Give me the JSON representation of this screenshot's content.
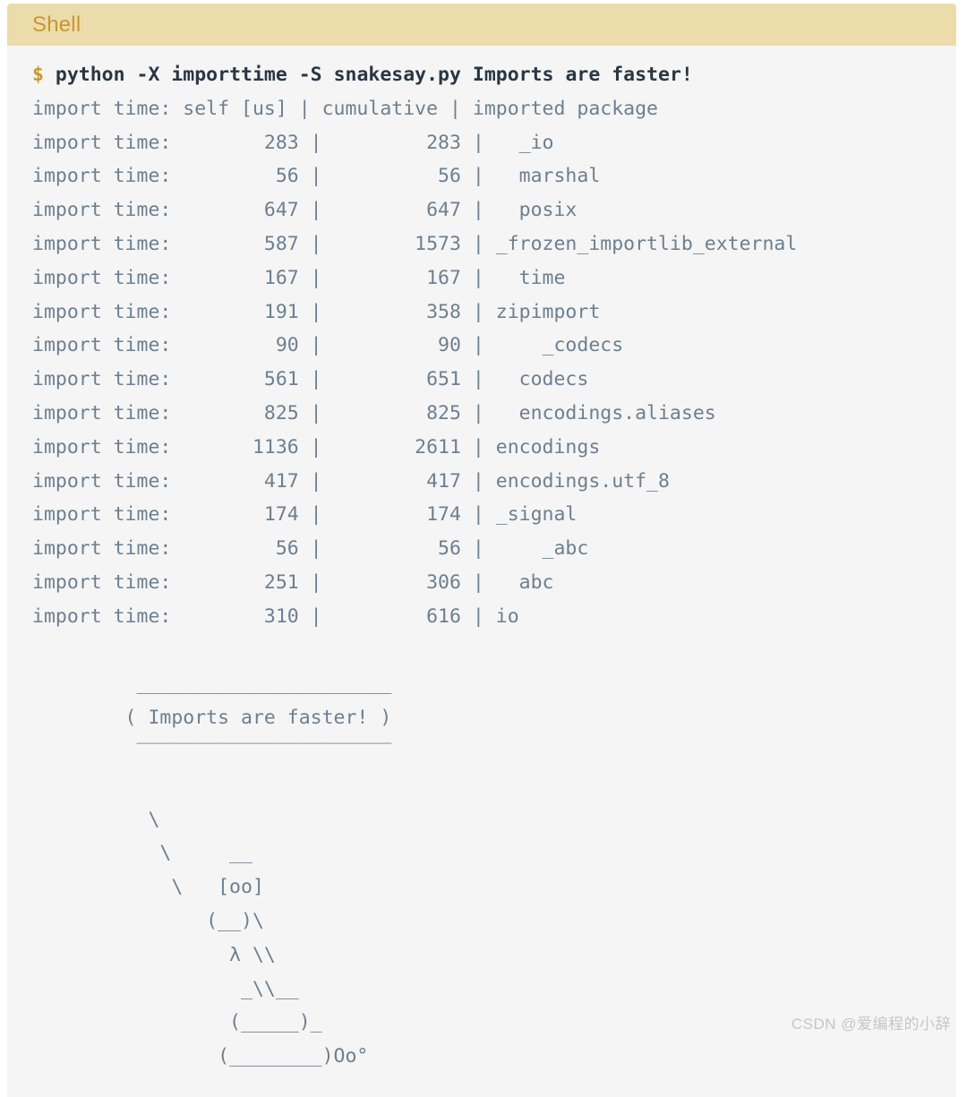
{
  "block": {
    "language_label": "Shell",
    "header_bg": "#ecdcab",
    "header_text_color": "#c8972e",
    "body_bg": "#f5f5f5",
    "output_text_color": "#6d7f90",
    "command_text_color": "#2a3642",
    "prompt_color": "#c49a2e"
  },
  "prompt": {
    "sigil": "$",
    "command": "python -X importtime -S snakesay.py Imports are faster!"
  },
  "table": {
    "header_line": "import time: self [us] | cumulative | imported package",
    "label": "import time:",
    "columns": [
      "self [us]",
      "cumulative",
      "imported package"
    ],
    "rows": [
      {
        "self_us": 283,
        "cumulative": 283,
        "package": "_io",
        "depth": 2
      },
      {
        "self_us": 56,
        "cumulative": 56,
        "package": "marshal",
        "depth": 2
      },
      {
        "self_us": 647,
        "cumulative": 647,
        "package": "posix",
        "depth": 2
      },
      {
        "self_us": 587,
        "cumulative": 1573,
        "package": "_frozen_importlib_external",
        "depth": 0
      },
      {
        "self_us": 167,
        "cumulative": 167,
        "package": "time",
        "depth": 2
      },
      {
        "self_us": 191,
        "cumulative": 358,
        "package": "zipimport",
        "depth": 0
      },
      {
        "self_us": 90,
        "cumulative": 90,
        "package": "_codecs",
        "depth": 4
      },
      {
        "self_us": 561,
        "cumulative": 651,
        "package": "codecs",
        "depth": 2
      },
      {
        "self_us": 825,
        "cumulative": 825,
        "package": "encodings.aliases",
        "depth": 2
      },
      {
        "self_us": 1136,
        "cumulative": 2611,
        "package": "encodings",
        "depth": 0
      },
      {
        "self_us": 417,
        "cumulative": 417,
        "package": "encodings.utf_8",
        "depth": 0
      },
      {
        "self_us": 174,
        "cumulative": 174,
        "package": "_signal",
        "depth": 0
      },
      {
        "self_us": 56,
        "cumulative": 56,
        "package": "_abc",
        "depth": 4
      },
      {
        "self_us": 251,
        "cumulative": 306,
        "package": "abc",
        "depth": 2
      },
      {
        "self_us": 310,
        "cumulative": 616,
        "package": "io",
        "depth": 0
      }
    ]
  },
  "ascii_art": {
    "speech_text": "Imports are faster!",
    "lines": [
      "",
      "        ______________________",
      "       ( Imports are faster! )",
      "        ----------------------",
      "",
      "          \\",
      "           \\     __",
      "            \\   [oo]",
      "               (__)\\",
      "                 λ \\\\",
      "                  _\\\\__",
      "                 (_____)_",
      "                (________)Oo°"
    ]
  },
  "watermark": {
    "text": "CSDN @爱编程的小辞"
  }
}
